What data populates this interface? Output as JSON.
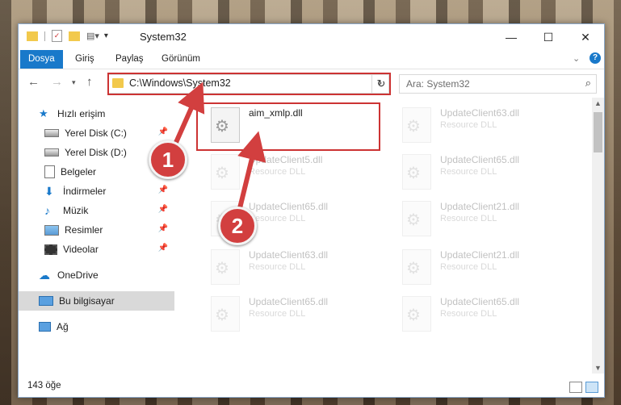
{
  "window": {
    "title": "System32",
    "minimize_glyph": "—",
    "maximize_glyph": "☐",
    "close_glyph": "✕"
  },
  "ribbon": {
    "tabs": [
      {
        "label": "Dosya",
        "active": true
      },
      {
        "label": "Giriş",
        "active": false
      },
      {
        "label": "Paylaş",
        "active": false
      },
      {
        "label": "Görünüm",
        "active": false
      }
    ]
  },
  "address": {
    "path": "C:\\Windows\\System32",
    "search_placeholder": "Ara: System32"
  },
  "sidebar": {
    "items": [
      {
        "label": "Hızlı erişim",
        "icon": "star-icon",
        "pinned": false
      },
      {
        "label": "Yerel Disk (C:)",
        "icon": "drive-icon",
        "pinned": true
      },
      {
        "label": "Yerel Disk (D:)",
        "icon": "drive-icon",
        "pinned": false
      },
      {
        "label": "Belgeler",
        "icon": "document-icon",
        "pinned": true
      },
      {
        "label": "İndirmeler",
        "icon": "download-icon",
        "pinned": true
      },
      {
        "label": "Müzik",
        "icon": "music-icon",
        "pinned": true
      },
      {
        "label": "Resimler",
        "icon": "pictures-icon",
        "pinned": true
      },
      {
        "label": "Videolar",
        "icon": "video-icon",
        "pinned": true
      },
      {
        "label": "OneDrive",
        "icon": "cloud-icon",
        "pinned": false
      },
      {
        "label": "Bu bilgisayar",
        "icon": "computer-icon",
        "pinned": false,
        "selected": true
      },
      {
        "label": "Ağ",
        "icon": "network-icon",
        "pinned": false
      }
    ]
  },
  "files": [
    {
      "name": "aim_xmlp.dll",
      "desc": "",
      "highlighted": true
    },
    {
      "name": "UpdateClient63.dll",
      "desc": "Resource DLL"
    },
    {
      "name": "UpdateClient5.dll",
      "desc": "Resource DLL"
    },
    {
      "name": "UpdateClient65.dll",
      "desc": "Resource DLL"
    },
    {
      "name": "UpdateClient65.dll",
      "desc": "Resource DLL"
    },
    {
      "name": "UpdateClient21.dll",
      "desc": "Resource DLL"
    },
    {
      "name": "UpdateClient63.dll",
      "desc": "Resource DLL"
    },
    {
      "name": "UpdateClient21.dll",
      "desc": "Resource DLL"
    },
    {
      "name": "UpdateClient65.dll",
      "desc": "Resource DLL"
    },
    {
      "name": "UpdateClient65.dll",
      "desc": "Resource DLL"
    }
  ],
  "status": {
    "item_count": "143 öğe"
  },
  "annotations": {
    "step1": "1",
    "step2": "2",
    "accent_color": "#d23f3f"
  }
}
